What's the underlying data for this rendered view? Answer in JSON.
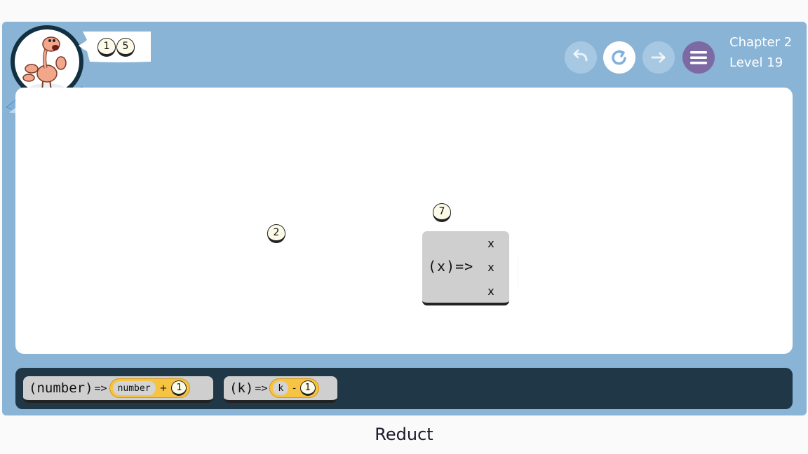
{
  "game": {
    "title": "Reduct",
    "chapter_label": "Chapter 2",
    "level_label": "Level 19"
  },
  "colors": {
    "frame": "#89b4d6",
    "board": "#ffffff",
    "toolbox": "#1f3747",
    "menu_button": "#7d6aa5",
    "expression_yellow": "#f6c342",
    "lambda_gray": "#cfcfcf",
    "number_cream": "#fdfbe8"
  },
  "icons": {
    "undo": "undo-arrow-icon",
    "reset": "reset-circular-arrow-icon",
    "redo": "redo-arrow-icon",
    "menu": "hamburger-menu-icon",
    "mascot": "ostrich-mascot-icon"
  },
  "goal": {
    "numbers": [
      "1",
      "5"
    ]
  },
  "board": {
    "number_a": "2",
    "number_b": "7",
    "lambda": {
      "param": "(x)",
      "arrow": "=>",
      "body": [
        "x",
        "x",
        "x"
      ]
    }
  },
  "toolbox": {
    "functions": [
      {
        "param": "(number)",
        "arrow": "=>",
        "var": "number",
        "op": "+",
        "operand": "1"
      },
      {
        "param": "(k)",
        "arrow": "=>",
        "var": "k",
        "op": "-",
        "operand": "1"
      }
    ]
  }
}
